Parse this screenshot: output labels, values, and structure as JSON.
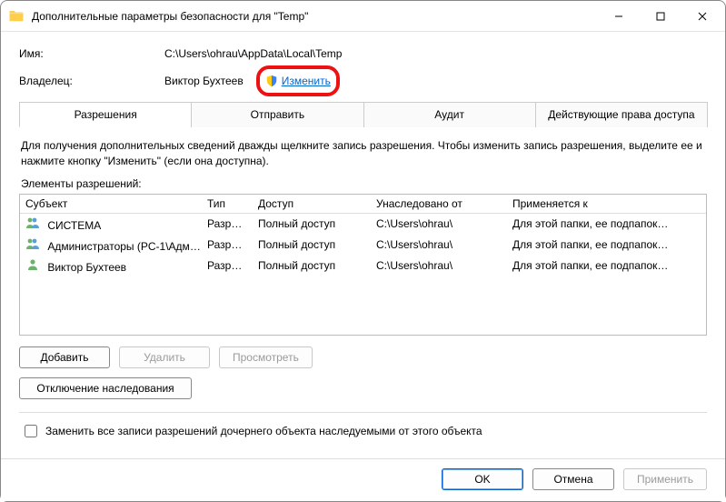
{
  "window": {
    "title": "Дополнительные параметры безопасности  для \"Temp\""
  },
  "info": {
    "name_label": "Имя:",
    "name_value": "C:\\Users\\ohrau\\AppData\\Local\\Temp",
    "owner_label": "Владелец:",
    "owner_value": "Виктор Бухтеев",
    "change_link": "Изменить"
  },
  "tabs": [
    {
      "label": "Разрешения"
    },
    {
      "label": "Отправить"
    },
    {
      "label": "Аудит"
    },
    {
      "label": "Действующие права доступа"
    }
  ],
  "hint": "Для получения дополнительных сведений дважды щелкните запись разрешения. Чтобы изменить запись разрешения, выделите ее и нажмите кнопку \"Изменить\" (если она доступна).",
  "section_label": "Элементы разрешений:",
  "grid": {
    "headers": {
      "subject": "Субъект",
      "type": "Тип",
      "access": "Доступ",
      "inherited": "Унаследовано от",
      "applies": "Применяется к"
    },
    "rows": [
      {
        "icon": "group",
        "subject": "СИСТЕМА",
        "type": "Разр…",
        "access": "Полный доступ",
        "inherited": "C:\\Users\\ohrau\\",
        "applies": "Для этой папки, ее подпапок…"
      },
      {
        "icon": "group",
        "subject": "Администраторы (PC-1\\Адми…",
        "type": "Разр…",
        "access": "Полный доступ",
        "inherited": "C:\\Users\\ohrau\\",
        "applies": "Для этой папки, ее подпапок…"
      },
      {
        "icon": "user",
        "subject": "Виктор Бухтеев",
        "type": "Разр…",
        "access": "Полный доступ",
        "inherited": "C:\\Users\\ohrau\\",
        "applies": "Для этой папки, ее подпапок…"
      }
    ]
  },
  "buttons": {
    "add": "Добавить",
    "remove": "Удалить",
    "view": "Просмотреть",
    "disable_inherit": "Отключение наследования"
  },
  "checkbox": {
    "replace_label": "Заменить все записи разрешений дочернего объекта наследуемыми от этого объекта"
  },
  "footer": {
    "ok": "OK",
    "cancel": "Отмена",
    "apply": "Применить"
  }
}
